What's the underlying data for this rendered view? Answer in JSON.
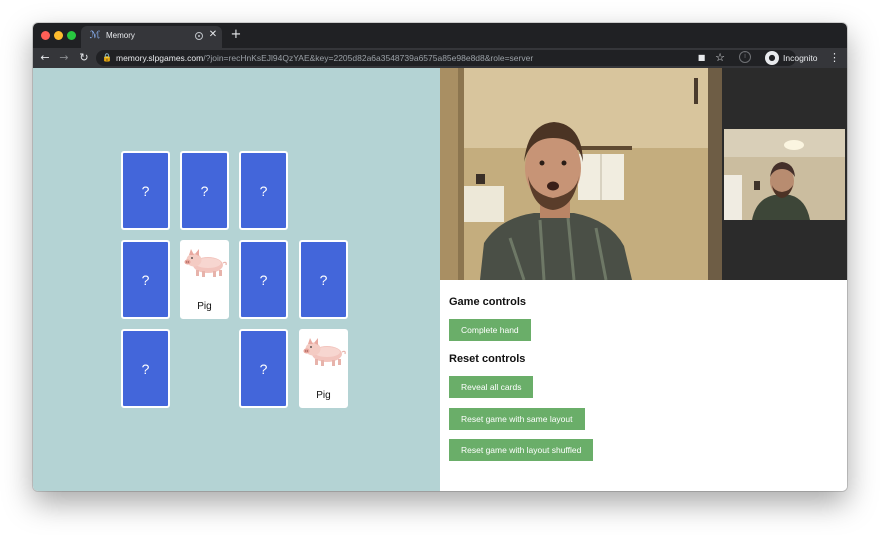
{
  "browser": {
    "tab_title": "Memory",
    "tab_favicon": "memory-logo-icon",
    "url_host": "memory.slpgames.com",
    "url_path": "/?join=recHnKsEJl94QzYAE&key=2205d82a6a3548739a6575a85e98e8d8&role=server",
    "profile_label": "Incognito"
  },
  "board": {
    "cards": [
      {
        "face": "?",
        "revealed": false
      },
      {
        "face": "?",
        "revealed": false
      },
      {
        "face": "?",
        "revealed": false
      },
      {
        "face": "?",
        "revealed": false
      },
      {
        "face": "Pig",
        "revealed": true,
        "image": "pig"
      },
      {
        "face": "?",
        "revealed": false
      },
      {
        "face": "?",
        "revealed": false
      },
      {
        "face": "?",
        "revealed": false
      },
      {
        "face": "?",
        "revealed": false
      },
      {
        "face": "Pig",
        "revealed": true,
        "image": "pig"
      }
    ]
  },
  "controls": {
    "game_heading": "Game controls",
    "complete_hand": "Complete hand",
    "reset_heading": "Reset controls",
    "reveal_all": "Reveal all cards",
    "reset_same": "Reset game with same layout",
    "reset_shuffled": "Reset game with layout shuffled"
  },
  "colors": {
    "board_bg": "#b4d3d4",
    "card_back": "#4366da",
    "button_green": "#6aae69"
  }
}
